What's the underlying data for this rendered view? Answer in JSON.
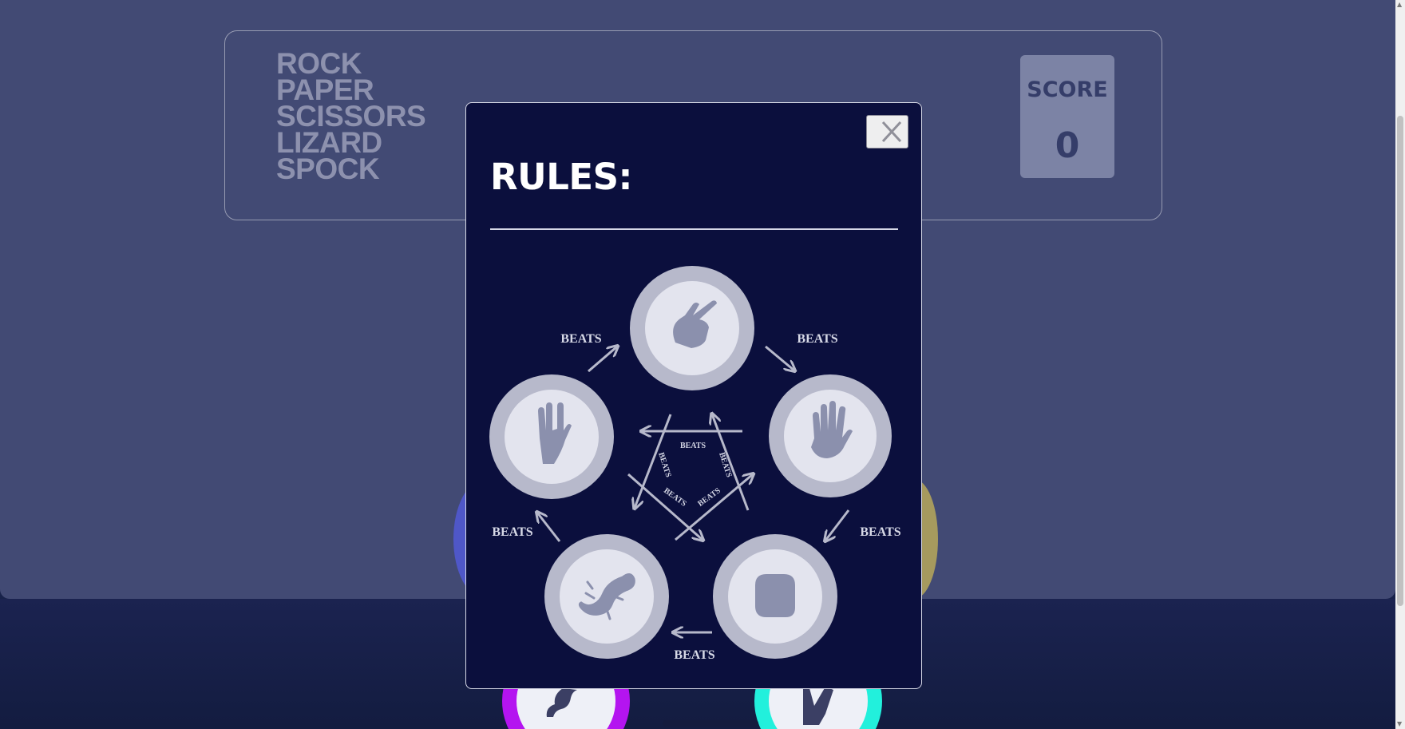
{
  "game": {
    "title_lines": [
      "ROCK",
      "PAPER",
      "SCISSORS",
      "LIZARD",
      "SPOCK"
    ],
    "score_label": "SCORE",
    "score_value": "0"
  },
  "modal": {
    "title": "RULES:",
    "close_label": "×"
  },
  "rules_diagram": {
    "beats_label": "BEATS",
    "moves": [
      "scissors",
      "paper",
      "rock",
      "lizard",
      "spock"
    ],
    "icons": [
      "scissors-hand-icon",
      "paper-hand-icon",
      "rock-fist-icon",
      "lizard-icon",
      "spock-hand-icon"
    ]
  },
  "colors": {
    "modal_bg": "#0b0f3d",
    "page_bg": "#424a74",
    "token_outer": "#b7b9cb",
    "token_inner": "#e3e4ee",
    "icon": "#8b90ad",
    "score_box": "#7c83a5",
    "lizard_ring": "#b414f0",
    "spock_ring": "#22f0dc"
  }
}
